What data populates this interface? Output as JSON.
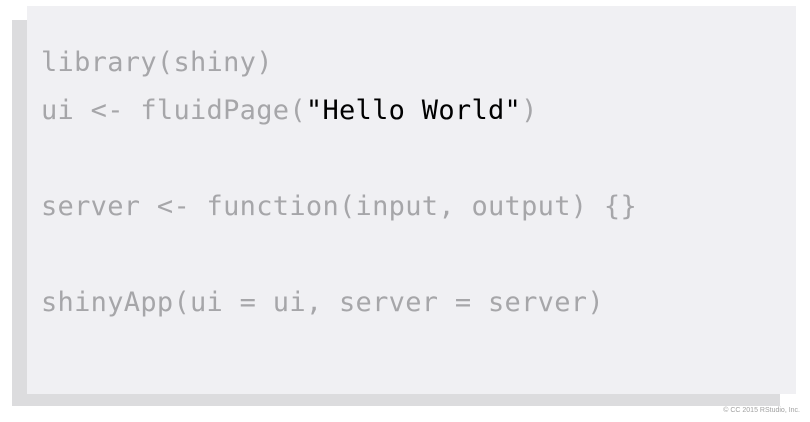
{
  "code": {
    "line1": "library(shiny)",
    "line2_prefix": "ui <- fluidPage(",
    "line2_highlight": "\"Hello World\"",
    "line2_suffix": ")",
    "line3": "server <- function(input, output) {}",
    "line4": "shinyApp(ui = ui, server = server)"
  },
  "footer": {
    "copyright": "© CC 2015 RStudio, Inc."
  },
  "colors": {
    "panel_bg": "#f0f0f3",
    "shadow": "#dcdcde",
    "code_dim": "#a6a6a9",
    "code_highlight": "#000000"
  }
}
